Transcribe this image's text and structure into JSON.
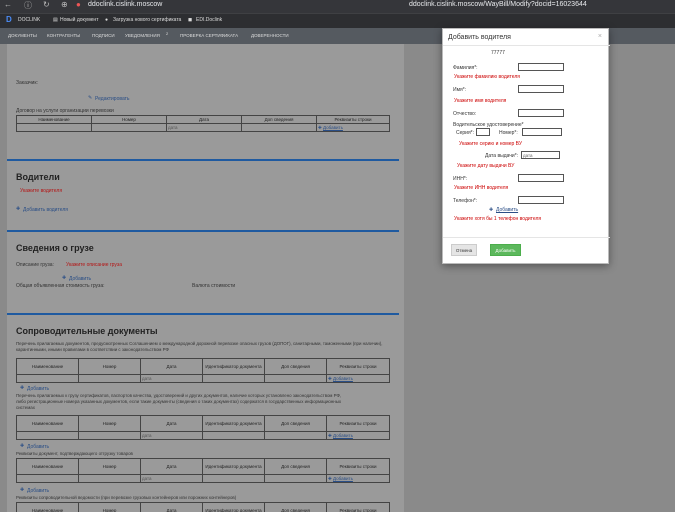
{
  "browser": {
    "url_host": "ddoclink.cislink.moscow",
    "url_full": "ddoclink.cislink.moscow/WayBill/Modify?docid=16023644"
  },
  "bookmarks": {
    "b1": "DOCLINK",
    "b2": "Новый документ",
    "b3": "Загрузка нового сертификата",
    "b4": "EDI.Doclink"
  },
  "nav": {
    "i1": "ДОКУМЕНТЫ",
    "i2": "КОНТРАГЕНТЫ",
    "i3": "ПОДПИСИ",
    "i4": "УВЕДОМЛЕНИЯ",
    "i4_badge": "2",
    "i5": "ПРОВЕРКА СЕРТИФИКАТА",
    "i6": "ДОВЕРЕННОСТИ"
  },
  "form": {
    "customer_label": "Заказчик:",
    "edit_link": "Редактировать",
    "contract_label": "Договор на услуги организации перевозки",
    "contract_cols": [
      "Наименование",
      "Номер",
      "Дата",
      "Доп сведения",
      "Реквизиты строки"
    ],
    "date_placeholder": "дата",
    "add_link": "Добавить",
    "drivers_title": "Водители",
    "drivers_error": "Укажите водителя",
    "add_driver_link": "Добавить водителя",
    "cargo_title": "Сведения о грузе",
    "cargo_desc_label": "Описание груза:",
    "cargo_desc_error": "Укажите описание груза",
    "declared_label": "Общая объявленная стоимость груза:",
    "currency_label": "Валюта стоимости",
    "docs_title": "Сопроводительные документы",
    "docs_p1": "Перечень прилагаемых документов, предусмотренных Соглашением о международной дорожной перевозке опасных грузов (ДОПОГ), санитарными, таможенными (при наличии), карантинными, иными правилами в соответствии с законодательством РФ",
    "docs_p2a": "Перечень прилагаемых к грузу сертификатов, паспортов качества, удостоверений и других документов, наличие которых установлено законодательством РФ,",
    "docs_p2b": "либо регистрационные номера указанных документов, если такие документы (сведения о таких документах) содержатся в государственных информационных",
    "docs_p2c": "системах",
    "docs_p3": "Реквизиты документ, подтверждающего отгрузку товаров",
    "docs_p4": "Реквизиты сопроводительной ведомости (при перевозке грузовых контейнеров или порожних контейнеров)",
    "doc_cols": [
      "Наименование",
      "Номер",
      "Дата",
      "Идентификатор документа",
      "Доп сведения",
      "Реквизиты строки"
    ]
  },
  "modal": {
    "title": "Добавить водителя",
    "close": "×",
    "subtitle": "77777",
    "surname_label": "Фамилия*:",
    "surname_error": "Укажите фамилию водителя",
    "name_label": "Имя*:",
    "name_error": "Укажите имя водителя",
    "patronymic_label": "Отчество:",
    "license_label": "Водительское удостоверение*",
    "series_label": "Серия*:",
    "number_label": "Номер*:",
    "series_error": "Укажите серию и номер ВУ",
    "issue_date_label": "Дата выдачи*:",
    "issue_date_placeholder": "дата",
    "issue_date_error": "Укажите дату выдачи ВУ",
    "inn_label": "ИНН*:",
    "inn_error": "Укажите ИНН водителя",
    "phone_label": "Телефон*:",
    "add_link": "Добавить",
    "phone_error": "Укажите хотя бы 1 телефон водителя",
    "cancel_button": "Отмена",
    "add_button": "Добавить"
  },
  "colors": {
    "accent": "#1f5aa0",
    "error": "#c00000",
    "success": "#5cb85c"
  }
}
